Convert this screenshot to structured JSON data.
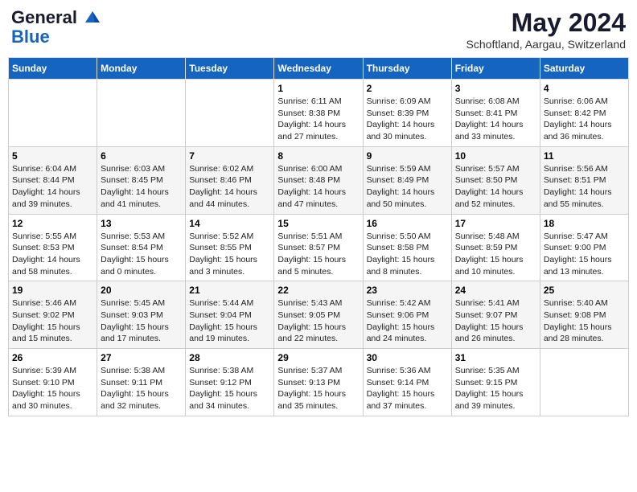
{
  "header": {
    "logo_general": "General",
    "logo_blue": "Blue",
    "month": "May 2024",
    "location": "Schoftland, Aargau, Switzerland"
  },
  "days_of_week": [
    "Sunday",
    "Monday",
    "Tuesday",
    "Wednesday",
    "Thursday",
    "Friday",
    "Saturday"
  ],
  "weeks": [
    [
      {
        "day": "",
        "info": ""
      },
      {
        "day": "",
        "info": ""
      },
      {
        "day": "",
        "info": ""
      },
      {
        "day": "1",
        "info": "Sunrise: 6:11 AM\nSunset: 8:38 PM\nDaylight: 14 hours\nand 27 minutes."
      },
      {
        "day": "2",
        "info": "Sunrise: 6:09 AM\nSunset: 8:39 PM\nDaylight: 14 hours\nand 30 minutes."
      },
      {
        "day": "3",
        "info": "Sunrise: 6:08 AM\nSunset: 8:41 PM\nDaylight: 14 hours\nand 33 minutes."
      },
      {
        "day": "4",
        "info": "Sunrise: 6:06 AM\nSunset: 8:42 PM\nDaylight: 14 hours\nand 36 minutes."
      }
    ],
    [
      {
        "day": "5",
        "info": "Sunrise: 6:04 AM\nSunset: 8:44 PM\nDaylight: 14 hours\nand 39 minutes."
      },
      {
        "day": "6",
        "info": "Sunrise: 6:03 AM\nSunset: 8:45 PM\nDaylight: 14 hours\nand 41 minutes."
      },
      {
        "day": "7",
        "info": "Sunrise: 6:02 AM\nSunset: 8:46 PM\nDaylight: 14 hours\nand 44 minutes."
      },
      {
        "day": "8",
        "info": "Sunrise: 6:00 AM\nSunset: 8:48 PM\nDaylight: 14 hours\nand 47 minutes."
      },
      {
        "day": "9",
        "info": "Sunrise: 5:59 AM\nSunset: 8:49 PM\nDaylight: 14 hours\nand 50 minutes."
      },
      {
        "day": "10",
        "info": "Sunrise: 5:57 AM\nSunset: 8:50 PM\nDaylight: 14 hours\nand 52 minutes."
      },
      {
        "day": "11",
        "info": "Sunrise: 5:56 AM\nSunset: 8:51 PM\nDaylight: 14 hours\nand 55 minutes."
      }
    ],
    [
      {
        "day": "12",
        "info": "Sunrise: 5:55 AM\nSunset: 8:53 PM\nDaylight: 14 hours\nand 58 minutes."
      },
      {
        "day": "13",
        "info": "Sunrise: 5:53 AM\nSunset: 8:54 PM\nDaylight: 15 hours\nand 0 minutes."
      },
      {
        "day": "14",
        "info": "Sunrise: 5:52 AM\nSunset: 8:55 PM\nDaylight: 15 hours\nand 3 minutes."
      },
      {
        "day": "15",
        "info": "Sunrise: 5:51 AM\nSunset: 8:57 PM\nDaylight: 15 hours\nand 5 minutes."
      },
      {
        "day": "16",
        "info": "Sunrise: 5:50 AM\nSunset: 8:58 PM\nDaylight: 15 hours\nand 8 minutes."
      },
      {
        "day": "17",
        "info": "Sunrise: 5:48 AM\nSunset: 8:59 PM\nDaylight: 15 hours\nand 10 minutes."
      },
      {
        "day": "18",
        "info": "Sunrise: 5:47 AM\nSunset: 9:00 PM\nDaylight: 15 hours\nand 13 minutes."
      }
    ],
    [
      {
        "day": "19",
        "info": "Sunrise: 5:46 AM\nSunset: 9:02 PM\nDaylight: 15 hours\nand 15 minutes."
      },
      {
        "day": "20",
        "info": "Sunrise: 5:45 AM\nSunset: 9:03 PM\nDaylight: 15 hours\nand 17 minutes."
      },
      {
        "day": "21",
        "info": "Sunrise: 5:44 AM\nSunset: 9:04 PM\nDaylight: 15 hours\nand 19 minutes."
      },
      {
        "day": "22",
        "info": "Sunrise: 5:43 AM\nSunset: 9:05 PM\nDaylight: 15 hours\nand 22 minutes."
      },
      {
        "day": "23",
        "info": "Sunrise: 5:42 AM\nSunset: 9:06 PM\nDaylight: 15 hours\nand 24 minutes."
      },
      {
        "day": "24",
        "info": "Sunrise: 5:41 AM\nSunset: 9:07 PM\nDaylight: 15 hours\nand 26 minutes."
      },
      {
        "day": "25",
        "info": "Sunrise: 5:40 AM\nSunset: 9:08 PM\nDaylight: 15 hours\nand 28 minutes."
      }
    ],
    [
      {
        "day": "26",
        "info": "Sunrise: 5:39 AM\nSunset: 9:10 PM\nDaylight: 15 hours\nand 30 minutes."
      },
      {
        "day": "27",
        "info": "Sunrise: 5:38 AM\nSunset: 9:11 PM\nDaylight: 15 hours\nand 32 minutes."
      },
      {
        "day": "28",
        "info": "Sunrise: 5:38 AM\nSunset: 9:12 PM\nDaylight: 15 hours\nand 34 minutes."
      },
      {
        "day": "29",
        "info": "Sunrise: 5:37 AM\nSunset: 9:13 PM\nDaylight: 15 hours\nand 35 minutes."
      },
      {
        "day": "30",
        "info": "Sunrise: 5:36 AM\nSunset: 9:14 PM\nDaylight: 15 hours\nand 37 minutes."
      },
      {
        "day": "31",
        "info": "Sunrise: 5:35 AM\nSunset: 9:15 PM\nDaylight: 15 hours\nand 39 minutes."
      },
      {
        "day": "",
        "info": ""
      }
    ]
  ]
}
